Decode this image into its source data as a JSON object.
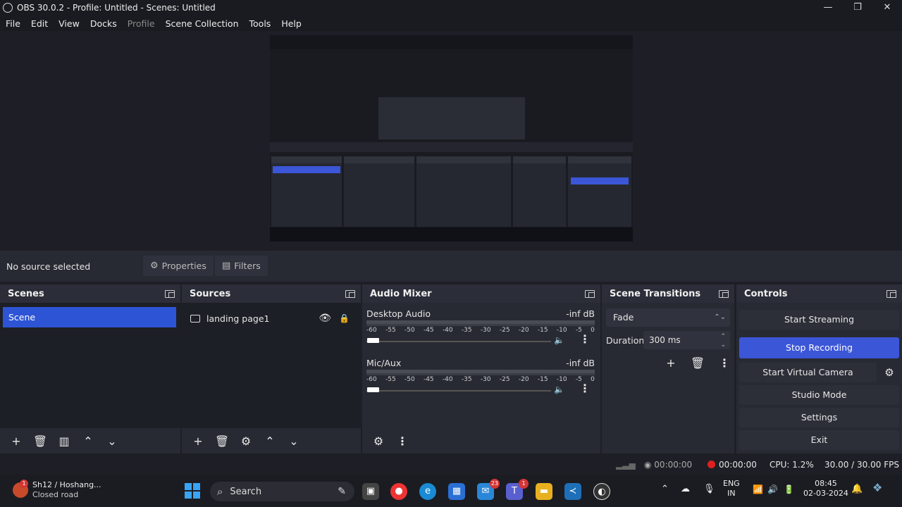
{
  "window": {
    "title": "OBS 30.0.2 - Profile: Untitled - Scenes: Untitled",
    "min": "—",
    "max": "❐",
    "close": "✕"
  },
  "menu": [
    "File",
    "Edit",
    "View",
    "Docks",
    "Profile",
    "Scene Collection",
    "Tools",
    "Help"
  ],
  "source_toolbar": {
    "no_source": "No source selected",
    "properties": "Properties",
    "filters": "Filters"
  },
  "scenes": {
    "title": "Scenes",
    "items": [
      "Scene"
    ]
  },
  "sources": {
    "title": "Sources",
    "items": [
      "landing page1"
    ]
  },
  "mixer": {
    "title": "Audio Mixer",
    "channels": [
      {
        "name": "Desktop Audio",
        "db": "-inf dB"
      },
      {
        "name": "Mic/Aux",
        "db": "-inf dB"
      }
    ],
    "ticks": [
      "-60",
      "-55",
      "-50",
      "-45",
      "-40",
      "-35",
      "-30",
      "-25",
      "-20",
      "-15",
      "-10",
      "-5",
      "0"
    ]
  },
  "transitions": {
    "title": "Scene Transitions",
    "selected": "Fade",
    "duration_label": "Duration",
    "duration_value": "300 ms"
  },
  "controls": {
    "title": "Controls",
    "start_streaming": "Start Streaming",
    "stop_recording": "Stop Recording",
    "start_virtual_camera": "Start Virtual Camera",
    "studio_mode": "Studio Mode",
    "settings": "Settings",
    "exit": "Exit"
  },
  "status": {
    "stream_time": "00:00:00",
    "rec_time": "00:00:00",
    "cpu": "CPU: 1.2%",
    "fps": "30.00 / 30.00 FPS"
  },
  "taskbar": {
    "weather_line1": "Sh12 / Hoshang...",
    "weather_line2": "Closed road",
    "weather_badge": "1",
    "search": "Search",
    "mail_badge": "23",
    "teams_badge": "1",
    "lang1": "ENG",
    "lang2": "IN",
    "time": "08:45",
    "date": "02-03-2024"
  },
  "colors": {
    "accent": "#3c56d8",
    "record": "#e02020",
    "panel": "#272a33"
  }
}
